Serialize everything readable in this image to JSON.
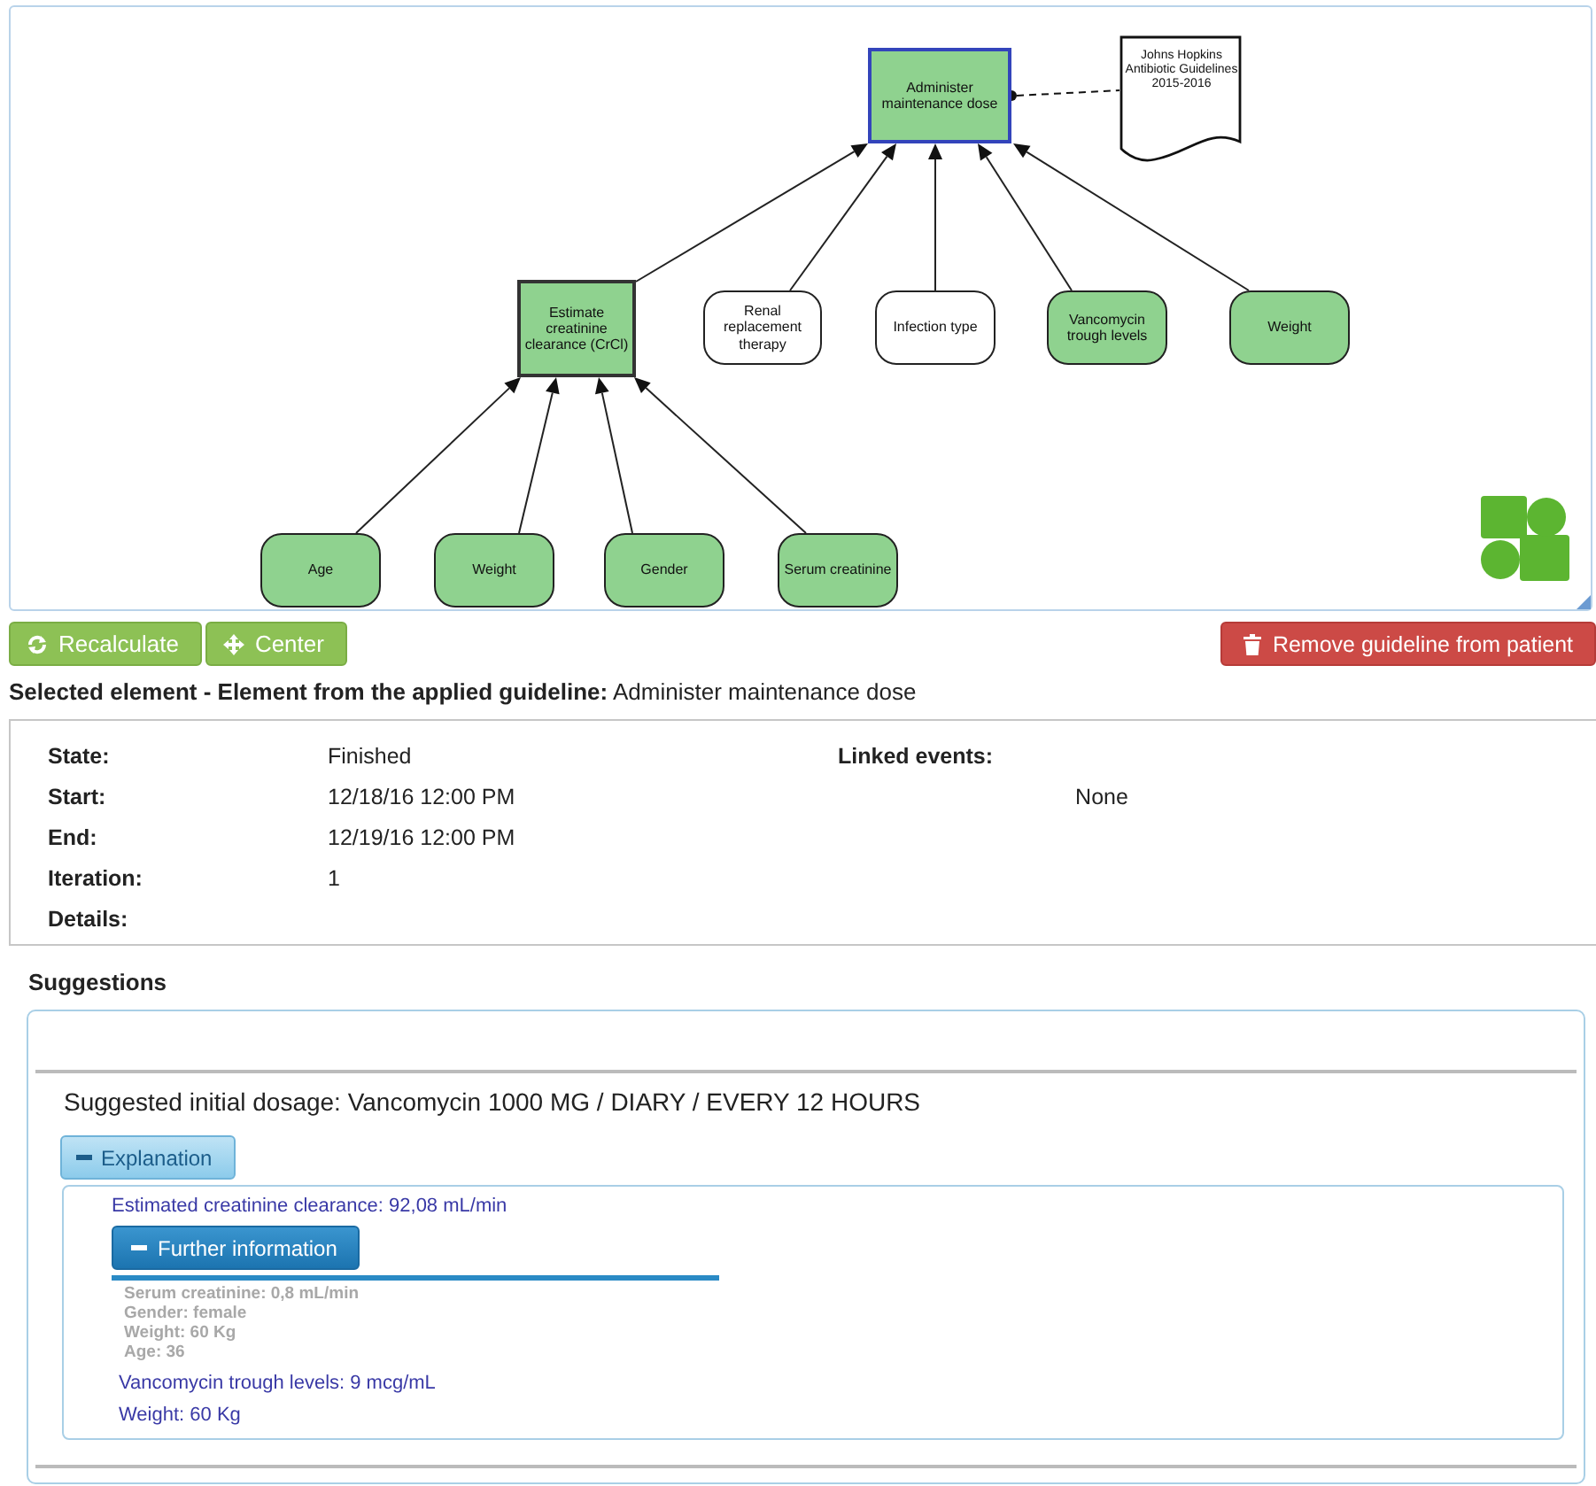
{
  "diagram": {
    "root": {
      "label": "Administer maintenance dose",
      "kind": "action",
      "completed": true,
      "selected": true,
      "children": [
        {
          "label": "Estimate creatinine clearance (CrCl)",
          "kind": "action",
          "completed": true,
          "selected": false,
          "children": [
            {
              "label": "Age",
              "kind": "data",
              "completed": true,
              "selected": false
            },
            {
              "label": "Weight",
              "kind": "data",
              "completed": true,
              "selected": false
            },
            {
              "label": "Gender",
              "kind": "data",
              "completed": true,
              "selected": false
            },
            {
              "label": "Serum creatinine",
              "kind": "data",
              "completed": true,
              "selected": false
            }
          ]
        },
        {
          "label": "Renal replacement therapy",
          "kind": "data",
          "completed": false,
          "selected": false
        },
        {
          "label": "Infection type",
          "kind": "data",
          "completed": false,
          "selected": false
        },
        {
          "label": "Vancomycin trough levels",
          "kind": "data",
          "completed": true,
          "selected": false
        },
        {
          "label": "Weight",
          "kind": "data",
          "completed": true,
          "selected": false
        }
      ]
    },
    "note": {
      "text": "Johns Hopkins Antibiotic Guidelines 2015-2016"
    }
  },
  "toolbar": {
    "buttons": [
      {
        "label": "Recalculate",
        "kind": "recalculate"
      },
      {
        "label": "Center",
        "kind": "center"
      }
    ],
    "remove_button": "Remove guideline from patient"
  },
  "selected_element": {
    "label": "Selected element - Element from the applied guideline:",
    "value": "Administer maintenance dose"
  },
  "details": {
    "rows": [
      {
        "label": "State:",
        "value": "Finished"
      },
      {
        "label": "Start:",
        "value": "12/18/16 12:00 PM"
      },
      {
        "label": "End:",
        "value": "12/19/16 12:00 PM"
      },
      {
        "label": "Iteration:",
        "value": "1"
      },
      {
        "label": "Details:"
      }
    ],
    "linked_events": {
      "label": "Linked events:",
      "value": "None"
    }
  },
  "suggestions": {
    "title": "Suggestions",
    "dosage": "Suggested initial dosage: Vancomycin 1000 MG / DIARY / EVERY 12 HOURS",
    "explanation": {
      "label": "Explanation",
      "expanded": true,
      "clearance": "Estimated creatinine clearance: 92,08 mL/min",
      "further": {
        "label": "Further information",
        "expanded": true,
        "lines": [
          "Serum creatinine: 0,8 mL/min",
          "Gender: female",
          "Weight: 60 Kg",
          "Age: 36"
        ]
      },
      "items": [
        "Vancomycin trough levels: 9 mcg/mL",
        "Weight: 60 Kg"
      ]
    }
  }
}
